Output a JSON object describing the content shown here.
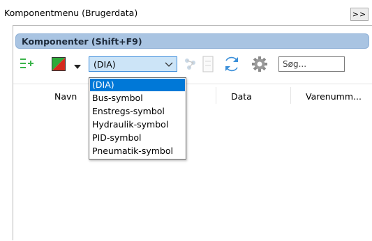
{
  "window": {
    "title": "Komponentmenu (Brugerdata)",
    "expand_label": ">>"
  },
  "panel": {
    "header": "Komponenter (Shift+F9)"
  },
  "toolbar": {
    "icons": [
      "add-component-icon",
      "color-flag-icon",
      "dropdown-arrow-icon",
      "component-tree-icon",
      "page-icon",
      "refresh-icon",
      "settings-icon"
    ],
    "filter_value": "(DIA)",
    "search_placeholder": "Søg..."
  },
  "dropdown": {
    "options": [
      "(DIA)",
      "Bus-symbol",
      "Enstregs-symbol",
      "Hydraulik-symbol",
      "PID-symbol",
      "Pneumatik-symbol"
    ],
    "selected_index": 0
  },
  "table": {
    "columns": [
      "Navn",
      "Data",
      "Varenumm..."
    ]
  },
  "colors": {
    "header_bg": "#a9c4e2",
    "selection": "#0078d7",
    "combo_bg": "#cce4f7",
    "add_icon_green": "#3cb44b",
    "refresh_blue": "#3b8fd9"
  }
}
